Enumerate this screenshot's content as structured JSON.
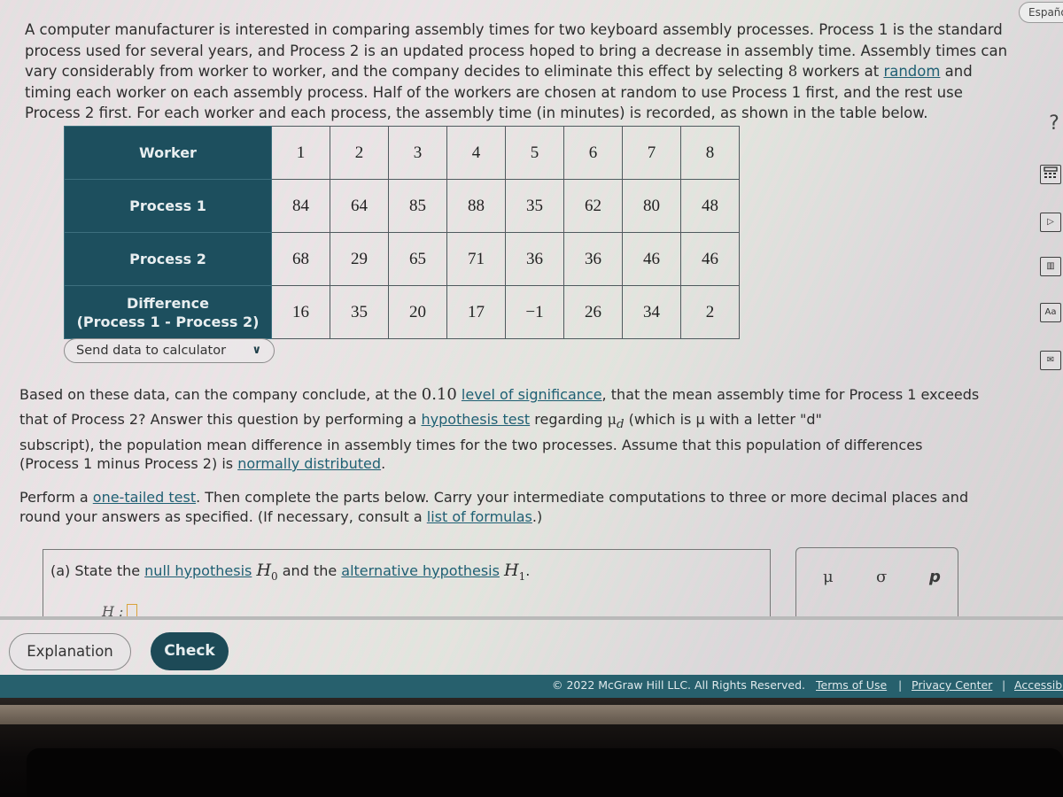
{
  "header": {
    "language_button": "Español"
  },
  "problem": {
    "intro_parts": [
      "A computer manufacturer is interested in comparing assembly times for two keyboard assembly processes. Process 1 is the standard process used for several years, and Process 2 is an updated process hoped to bring a decrease in assembly time. Assembly times can vary considerably from worker to worker, and the company decides to eliminate this effect by selecting ",
      "8",
      " workers at ",
      "random",
      " and timing each worker on each assembly process. Half of the workers are chosen at random to use Process 1 first, and the rest use Process 2 first. For each worker and each process, the assembly time (in minutes) is recorded, as shown in the table below."
    ]
  },
  "table": {
    "row_headers": {
      "worker": "Worker",
      "process1": "Process 1",
      "process2": "Process 2",
      "difference_line1": "Difference",
      "difference_line2": "(Process 1 - Process 2)"
    },
    "workers": [
      "1",
      "2",
      "3",
      "4",
      "5",
      "6",
      "7",
      "8"
    ],
    "process1": [
      "84",
      "64",
      "85",
      "88",
      "35",
      "62",
      "80",
      "48"
    ],
    "process2": [
      "68",
      "29",
      "65",
      "71",
      "36",
      "36",
      "46",
      "46"
    ],
    "difference": [
      "16",
      "35",
      "20",
      "17",
      "−1",
      "26",
      "34",
      "2"
    ]
  },
  "send_data": {
    "label": "Send data to calculator",
    "chevron": "∨"
  },
  "question": {
    "p1_a": "Based on these data, can the company conclude, at the ",
    "p1_alpha": "0.10",
    "p1_link1": "level of significance",
    "p1_b": ", that the mean assembly time for Process 1 exceeds that of Process 2? Answer this question by performing a ",
    "p1_link2": "hypothesis test",
    "p1_c": " regarding ",
    "mu": "μ",
    "mu_sub": "d",
    "p1_d": " (which is μ with a letter \"d\"",
    "p2_a": "subscript), the population mean difference in assembly times for the two processes. Assume that this population of differences (Process 1 minus Process 2) is ",
    "p2_link": "normally distributed",
    "p2_b": ".",
    "p3_a": "Perform a ",
    "p3_link1": "one-tailed test",
    "p3_b": ". Then complete the parts below. Carry your intermediate computations to three or more decimal places and round your answers as specified. (If necessary, consult a ",
    "p3_link2": "list of formulas",
    "p3_c": ".)"
  },
  "part_a": {
    "prefix": "(a)  State the ",
    "null_link": "null hypothesis",
    "h": "H",
    "h0_sub": "0",
    "middle": " and the ",
    "alt_link": "alternative hypothesis",
    "h1_sub": "1",
    "end": ".",
    "row_label": "H",
    "row_colon": " :"
  },
  "palette": {
    "symbols": [
      "μ",
      "σ",
      "p"
    ]
  },
  "buttons": {
    "explanation": "Explanation",
    "check": "Check"
  },
  "footer": {
    "copyright": "© 2022 McGraw Hill LLC. All Rights Reserved.",
    "terms": "Terms of Use",
    "privacy": "Privacy Center",
    "accessibility": "Accessibi",
    "separator": "|"
  },
  "side_tools": {
    "help": "?",
    "calculator": "calculator",
    "video": "▷",
    "book": "▥",
    "text": "Aa",
    "mail": "✉"
  }
}
